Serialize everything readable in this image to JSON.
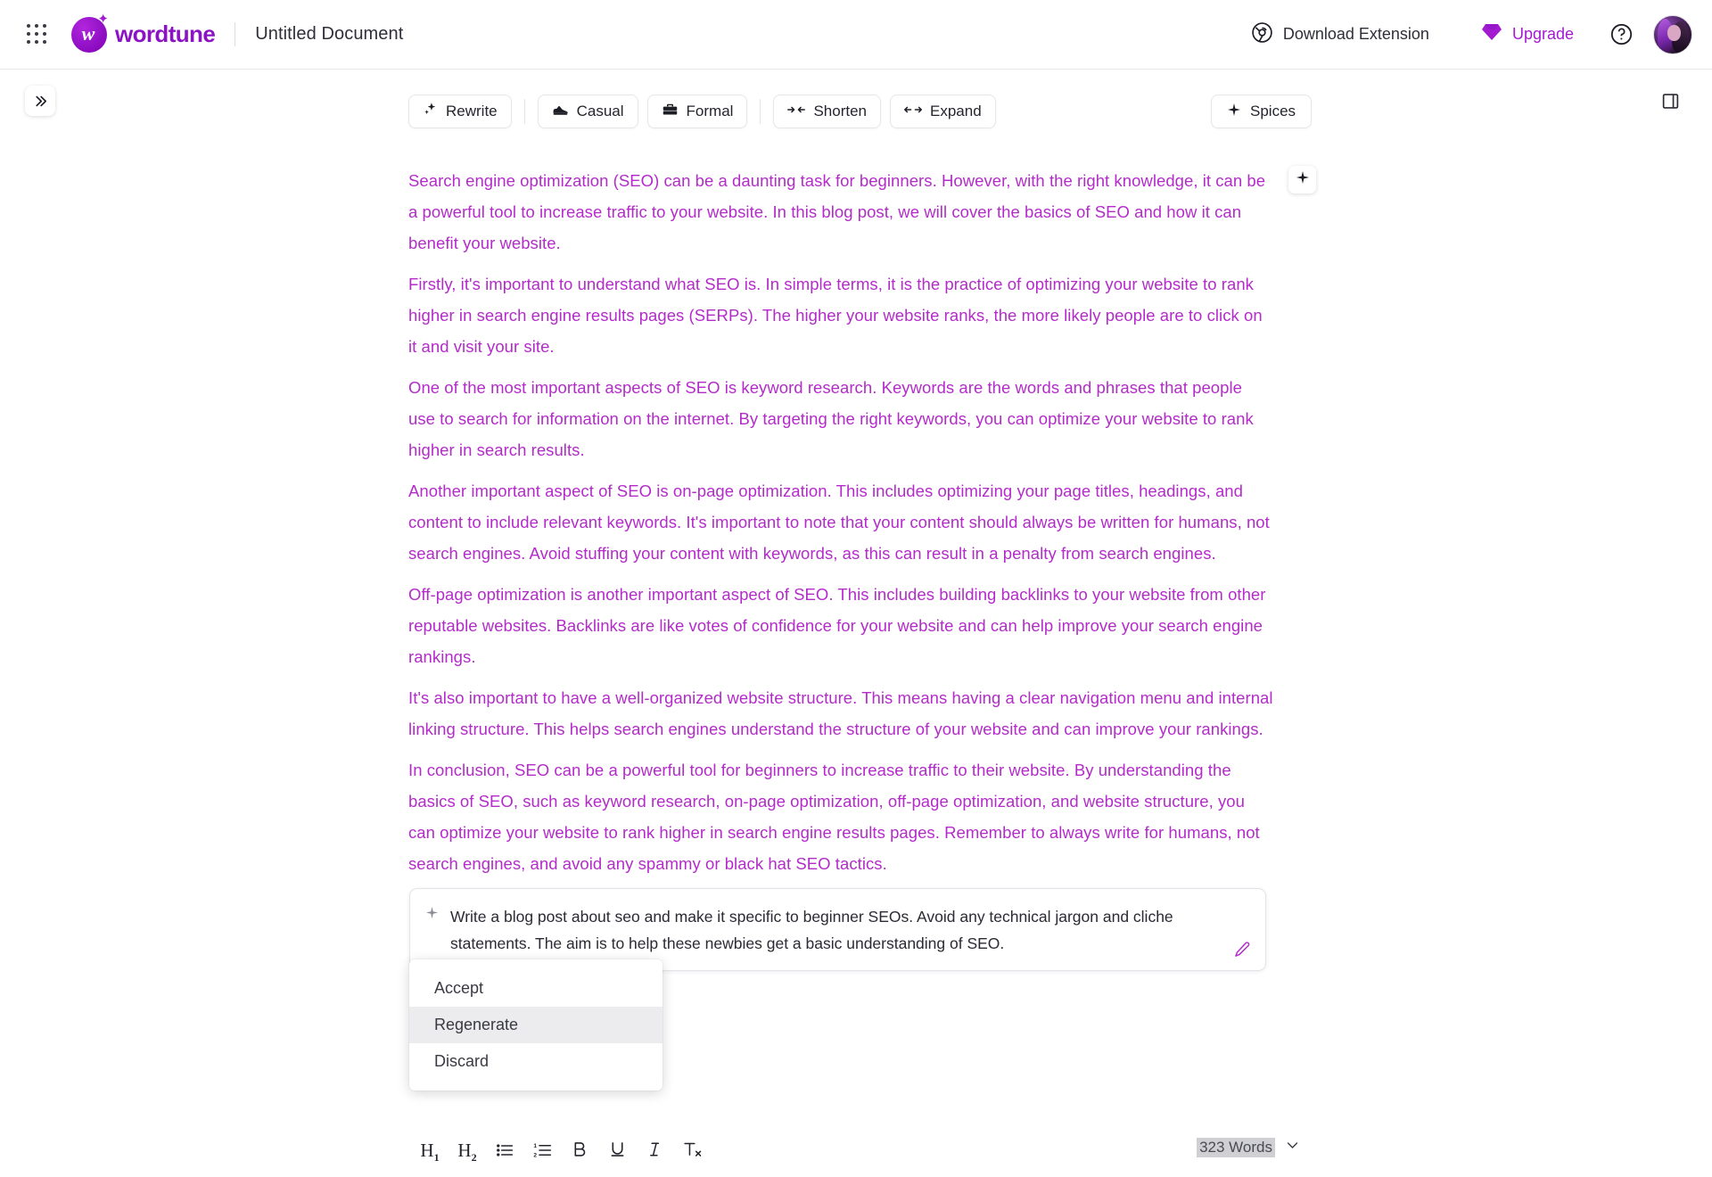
{
  "header": {
    "apps_icon": "grid-apps-icon",
    "brand": "wordtune",
    "doc_title": "Untitled Document",
    "download_extension_label": "Download Extension",
    "download_extension_icon": "chrome-icon",
    "upgrade_label": "Upgrade",
    "upgrade_icon": "diamond-icon",
    "help_icon": "help-circle-icon",
    "avatar_icon": "user-avatar",
    "brand_color": "#8c13c4",
    "accent_color": "#a21bd0"
  },
  "toolbar": {
    "sidebar_toggle_icon": "chevrons-right-icon",
    "panel_toggle_icon": "panel-right-icon",
    "buttons": [
      {
        "label": "Rewrite",
        "icon": "sparkles-icon"
      },
      {
        "label": "Casual",
        "icon": "sneaker-icon"
      },
      {
        "label": "Formal",
        "icon": "briefcase-icon"
      },
      {
        "label": "Shorten",
        "icon": "arrows-in-icon"
      },
      {
        "label": "Expand",
        "icon": "arrows-out-icon"
      }
    ],
    "spices": {
      "label": "Spices",
      "icon": "sparkle-plus-icon"
    }
  },
  "document": {
    "text_color": "#b32cc9",
    "add_paragraph_icon": "sparkle-icon",
    "paragraphs": [
      "Search engine optimization (SEO) can be a daunting task for beginners. However, with the right knowledge, it can be a powerful tool to increase traffic to your website. In this blog post, we will cover the basics of SEO and how it can benefit your website.",
      "Firstly, it's important to understand what SEO is. In simple terms, it is the practice of optimizing your website to rank higher in search engine results pages (SERPs). The higher your website ranks, the more likely people are to click on it and visit your site.",
      "One of the most important aspects of SEO is keyword research. Keywords are the words and phrases that people use to search for information on the internet. By targeting the right keywords, you can optimize your website to rank higher in search results.",
      "Another important aspect of SEO is on-page optimization. This includes optimizing your page titles, headings, and content to include relevant keywords. It's important to note that your content should always be written for humans, not search engines. Avoid stuffing your content with keywords, as this can result in a penalty from search engines.",
      "Off-page optimization is another important aspect of SEO. This includes building backlinks to your website from other reputable websites. Backlinks are like votes of confidence for your website and can help improve your search engine rankings.",
      "It's also important to have a well-organized website structure. This means having a clear navigation menu and internal linking structure. This helps search engines understand the structure of your website and can improve your rankings.",
      "In conclusion, SEO can be a powerful tool for beginners to increase traffic to their website. By understanding the basics of SEO, such as keyword research, on-page optimization, off-page optimization, and website structure, you can optimize your website to rank higher in search engine results pages. Remember to always write for humans, not search engines, and avoid any spammy or black hat SEO tactics."
    ]
  },
  "prompt": {
    "icon": "sparkle-icon",
    "text": "Write a blog post about seo and make it specific to beginner SEOs. Avoid any technical jargon and cliche statements. The aim is to help these newbies get a basic understanding of SEO.",
    "edit_icon": "pencil-icon"
  },
  "menu": {
    "items": [
      {
        "label": "Accept",
        "active": false
      },
      {
        "label": "Regenerate",
        "active": true
      },
      {
        "label": "Discard",
        "active": false
      }
    ]
  },
  "format_bar": {
    "buttons": [
      {
        "name": "heading-1",
        "icon": "h1-icon"
      },
      {
        "name": "heading-2",
        "icon": "h2-icon"
      },
      {
        "name": "bulleted-list",
        "icon": "bullet-list-icon"
      },
      {
        "name": "numbered-list",
        "icon": "numbered-list-icon"
      },
      {
        "name": "bold",
        "icon": "bold-icon"
      },
      {
        "name": "underline",
        "icon": "underline-icon"
      },
      {
        "name": "italic",
        "icon": "italic-icon"
      },
      {
        "name": "clear-formatting",
        "icon": "clear-format-icon"
      }
    ]
  },
  "status": {
    "word_count": "323 Words",
    "chevron_icon": "chevron-down-icon"
  }
}
